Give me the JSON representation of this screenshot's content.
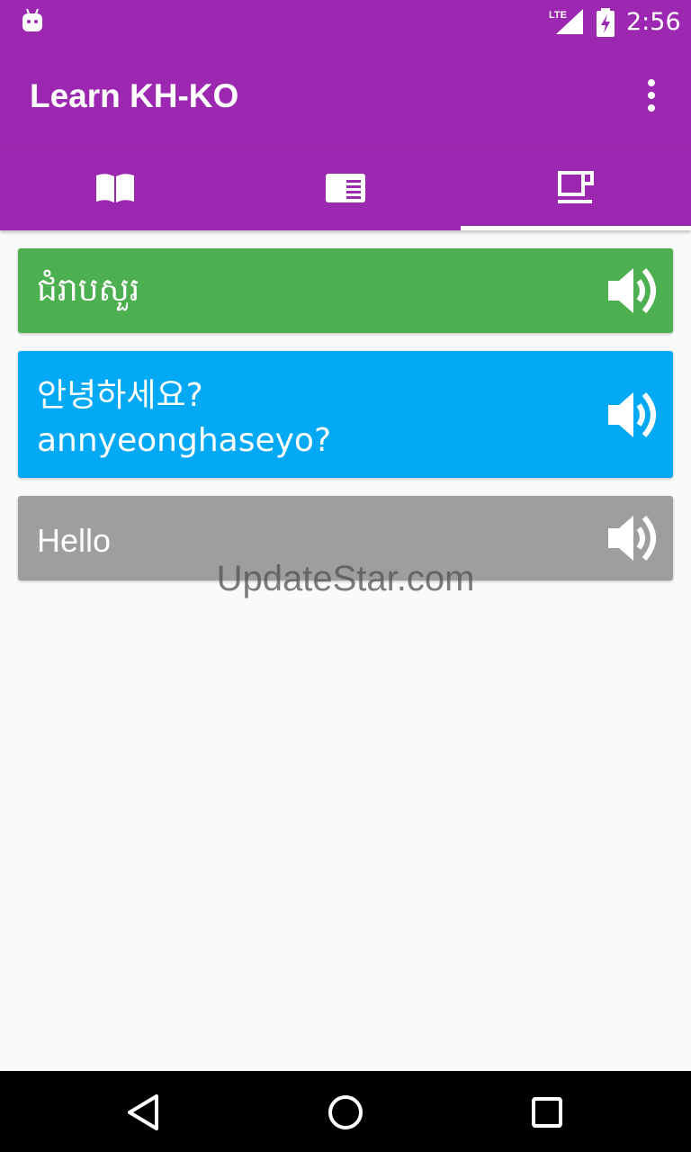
{
  "status_bar": {
    "time": "2:56",
    "icons": [
      "android-icon",
      "lte-signal-icon",
      "battery-charging-icon"
    ],
    "network_label": "LTE"
  },
  "app_bar": {
    "title": "Learn KH-KO",
    "menu_icon": "more-vertical-icon"
  },
  "tabs": [
    {
      "icon": "book-icon",
      "active": false
    },
    {
      "icon": "article-icon",
      "active": false
    },
    {
      "icon": "coffee-cup-icon",
      "active": true
    }
  ],
  "cards": {
    "khmer": {
      "text": "ជំរាបសួរ",
      "color": "#4caf50",
      "icon": "volume-up-icon"
    },
    "korean": {
      "text": "안녕하세요?",
      "romanized": "annyeonghaseyo?",
      "color": "#03a9f4",
      "icon": "volume-up-icon"
    },
    "english": {
      "text": "Hello",
      "color": "#9e9e9e",
      "icon": "volume-up-icon"
    }
  },
  "watermark": "UpdateStar.com",
  "nav_bar": {
    "buttons": [
      "back-triangle-icon",
      "home-circle-icon",
      "recents-square-icon"
    ]
  },
  "colors": {
    "primary": "#9c27b0",
    "background": "#fafafa"
  }
}
